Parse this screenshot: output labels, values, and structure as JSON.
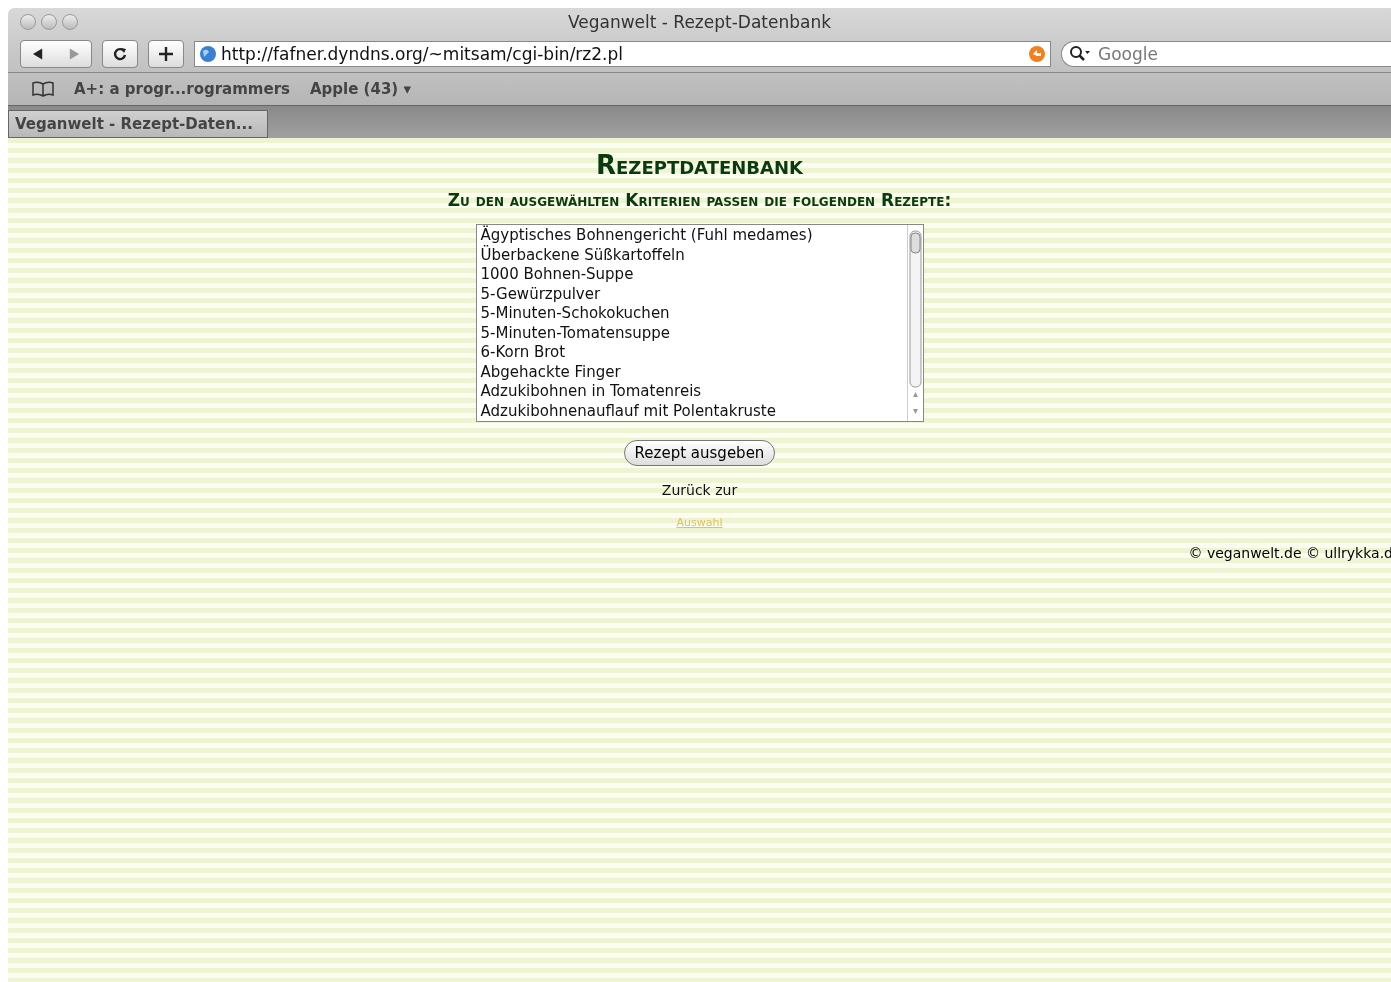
{
  "window": {
    "title": "Veganwelt - Rezept-Datenbank"
  },
  "toolbar": {
    "url": "http://fafner.dyndns.org/~mitsam/cgi-bin/rz2.pl",
    "search": {
      "placeholder": "Google"
    }
  },
  "bookmarks": [
    "A+: a progr...rogrammers",
    "Apple (43) ▾"
  ],
  "tabs": [
    {
      "label": "Veganwelt - Rezept-Daten...",
      "selected": true
    }
  ],
  "page": {
    "title": "Rezeptdatenbank",
    "subtitle": "Zu den ausgewählten Kriterien passen die folgenden Rezepte:",
    "recipes": [
      "Ägyptisches Bohnengericht (Fuhl medames)",
      "Überbackene Süßkartoffeln",
      "1000 Bohnen-Suppe",
      "5-Gewürzpulver",
      "5-Minuten-Schokokuchen",
      "5-Minuten-Tomatensuppe",
      "6-Korn Brot",
      "Abgehackte Finger",
      "Adzukibohnen in Tomatenreis",
      "Adzukibohnenauflauf mit Polentakruste"
    ],
    "button": "Rezept ausgeben",
    "back_text": "Zurück zur",
    "back_link": "Auswahl",
    "footer": "© veganwelt.de © ullrykka.d"
  }
}
